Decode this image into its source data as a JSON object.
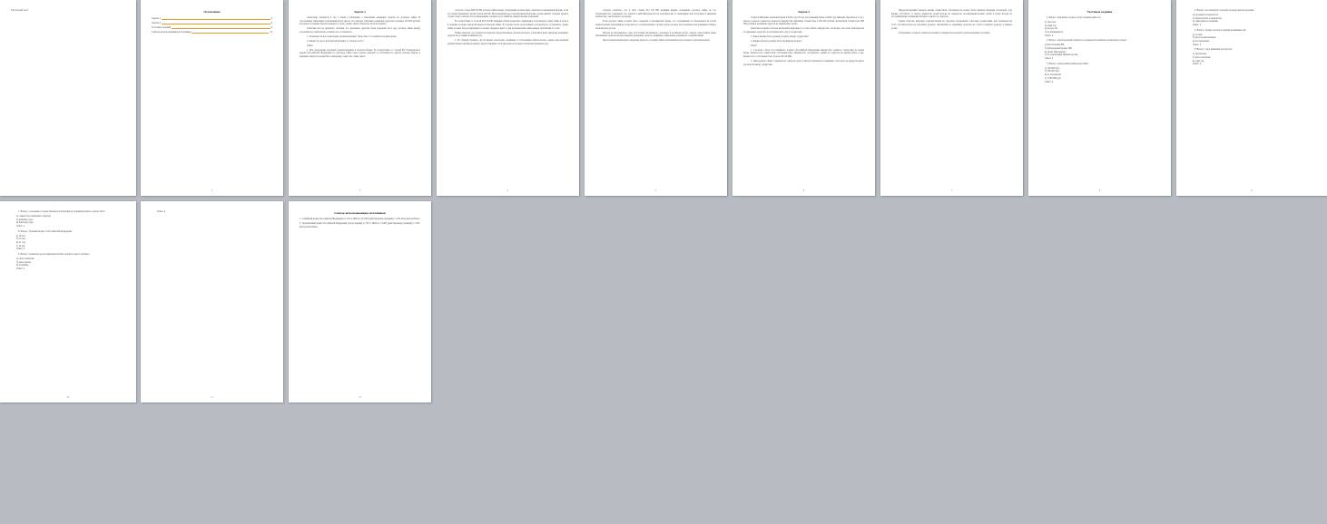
{
  "document": {
    "page1": {
      "title_text": "Титульный лист",
      "number": ""
    },
    "page2": {
      "title": "Оглавление",
      "toc": [
        {
          "label": "Задача 1",
          "page": "3"
        },
        {
          "label": "Задача 2",
          "page": "8"
        },
        {
          "label": "Тестовые задания",
          "page": "9"
        },
        {
          "label": "Список использованных источников",
          "page": "12"
        }
      ],
      "number": "2"
    },
    "page3": {
      "title": "Задача 1",
      "paras": [
        "Александр обратился в суд с иском к Екатерине о взыскании денежных средств по договору займа. В обоснование заявленных требований истец указал, что передал ответчику денежные средства в размере 150 000 рублей, которые последняя обязалась вернуть в срок, однако своих обязательств не исполнила.",
        "Ответчик иск не признала, пояснив, что денежные средства были переданы ей в дар, договор займа между сторонами не заключался, расписка не составлялась.",
        "1. Подлежит ли иск Александра удовлетворению? Дать ответ со ссылкой на нормы права.",
        "2. Может ли суд освободить Екатерину от уплаты долга?",
        "Ответ:",
        "1. Иск Александра подлежит удовлетворению в полном объеме. В соответствии со статьей 807 Гражданского кодекса Российской Федерации по договору займа одна сторона передает в собственность другой стороне деньги, а заемщик обязуется возвратить заимодавцу такую же сумму денег."
      ],
      "number": "3"
    },
    "page4": {
      "paras": [
        "согласно статье 808 ГК РФ договор займа между гражданами должен быть заключен в письменной форме, если его сумма превышает десять тысяч рублей. Несоблюдение простой письменной формы сделки лишает стороны права в случае спора ссылаться в подтверждение сделки и ее условий на свидетельские показания.",
        "В соответствии со статьей 810 ГК РФ заемщик обязан возвратить заимодавцу полученную сумму займа в срок и в порядке, которые предусмотрены договором займа. В случаях, когда срок возврата договором не установлен, сумма займа должна быть возвращена в течение тридцати дней со дня предъявления заимодавцем требования об этом.",
        "Таким образом, суд должен исследовать представленные доказательства и установить факт передачи денежных средств на условиях возвратности.",
        "2. По общему правилу суд не вправе освободить заемщика от исполнения обязательства, однако при наличии уважительных причин возможно предоставление отсрочки или рассрочки исполнения решения суда."
      ],
      "number": "4"
    },
    "page5": {
      "paras": [
        "Следует отметить, что в силу статьи 812 ГК РФ заемщик вправе оспаривать договор займа по его безденежности, доказывая, что деньги в действительности не получены им от заимодавца или получены в меньшем количестве, чем указано в договоре.",
        "Если договор займа должен быть совершен в письменной форме, его оспаривание по безденежности путем свидетельских показаний не допускается, за исключением случаев, когда договор был заключен под влиянием обмана, насилия или угрозы.",
        "Исходя из изложенного, при отсутствии письменного договора и расписки истцу следует представить иные письменные доказательства передачи денежных средств, например, банковские документы о перечислении.",
        "При подтверждении факта передачи денег на условиях займа требования истца подлежат удовлетворению."
      ],
      "number": "5"
    },
    "page6": {
      "title": "Задача 2",
      "paras": [
        "Супруги Ивановы заключили брак в 2010 году. После расторжения брака в 2020 году Иванова обратилась в суд с иском о разделе совместно нажитого имущества: квартиры стоимостью 4 500 000 рублей, автомобиля стоимостью 800 000 рублей и денежных средств на банковских счетах.",
        "Ответчик возражал против включения квартиры в состав общего имущества, поскольку она была приобретена на денежные средства, полученные им в дар от родителей.",
        "1. Какое имущество подлежит разделу между супругами?",
        "2. Каким образом должен быть произведен раздел?",
        "Ответ:",
        "1. Согласно статье 34 Семейного кодекса Российской Федерации имущество, нажитое супругами во время брака, является их совместной собственностью. Имущество, полученное одним из супругов во время брака в дар, является его собственностью (статья 36 СК РФ).",
        "2. При разделе общего имущества супругов доли супругов признаются равными, если иное не предусмотрено договором между супругами."
      ],
      "number": "6"
    },
    "page7": {
      "paras": [
        "Предусмотренный законом режим совместной собственности может быть изменен брачным договором. Суд вправе отступить от начала равенства долей исходя из интересов несовершеннолетних детей и (или) исходя из заслуживающего внимания интереса одного из супругов.",
        "Таким образом, квартира, приобретенная на средства, подаренные ответчику родителями, при доказанности этого обстоятельства не подлежит разделу. Автомобиль и денежные средства на счетах подлежат разделу в равных долях.",
        "Требования о разделе совместно нажитого имущества подлежат удовлетворению частично."
      ],
      "number": "7"
    },
    "page8": {
      "title": "Тестовые задания",
      "q": [
        "1. Вопрос: при каком сроке не течет исковая давность:",
        "а) три года;",
        "б) один год;",
        "в) десять лет;",
        "г) не применяется.",
        "Ответ: в",
        "2. Вопрос: какой документ является основным источником гражданского права:",
        "а) Конституция РФ;",
        "б) Гражданский кодекс РФ;",
        "в) указы Президента;",
        "г) постановления Правительства.",
        "Ответ: б",
        "3. Вопрос: предельный размер неустойки:",
        "а) 100 000 руб.;",
        "б) 500 000 руб.;",
        "в) не ограничен;",
        "г) 1 000 000 руб.",
        "Ответ: в"
      ],
      "number": "8"
    },
    "page9": {
      "q": [
        "4. Вопрос: кто является стороной договора купли-продажи:",
        "а) продавец и покупатель;",
        "б) арендодатель и арендатор;",
        "в) заимодавец и заемщик.",
        "Ответ: а",
        "5. Вопрос: форма договора дарения недвижимости:",
        "а) устная;",
        "б) простая письменная;",
        "в) нотариальная.",
        "Ответ: б",
        "6. Вопрос: срок принятия наследства:",
        "а) три месяца;",
        "б) шесть месяцев;",
        "в) один год.",
        "Ответ: б"
      ],
      "number": "9"
    },
    "page10": {
      "q": [
        "7. Вопрос: основание государственной регистрации расторжения брака в органе ЗАГС:",
        "а) совместное заявление супругов;",
        "б) решение суда;",
        "в) приговор суда.",
        "Ответ: а",
        "8. Вопрос: брачный возраст в Российской Федерации:",
        "а) 16 лет;",
        "б) 18 лет;",
        "в) 21 год;",
        "г) 14 лет.",
        "Ответ: б",
        "9. Вопрос: алименты на несовершеннолетних детей на одного ребенка:",
        "а) одна четвертая;",
        "б) одна третья;",
        "в) половина.",
        "Ответ: а"
      ],
      "number": "10"
    },
    "page11": {
      "q": [
        "Ответ: в"
      ],
      "number": "11"
    },
    "page12": {
      "title": "Список использованных источников",
      "items": [
        "1. Семейный кодекс Российской Федерации от 29.12.1995 № 223-ФЗ (действующая редакция) // СПС КонсультантПлюс.",
        "2. Гражданский кодекс Российской Федерации (часть первая) от 30.11.1994 № 51-ФЗ (действующая редакция) // СПС КонсультантПлюс."
      ],
      "number": "12"
    }
  }
}
